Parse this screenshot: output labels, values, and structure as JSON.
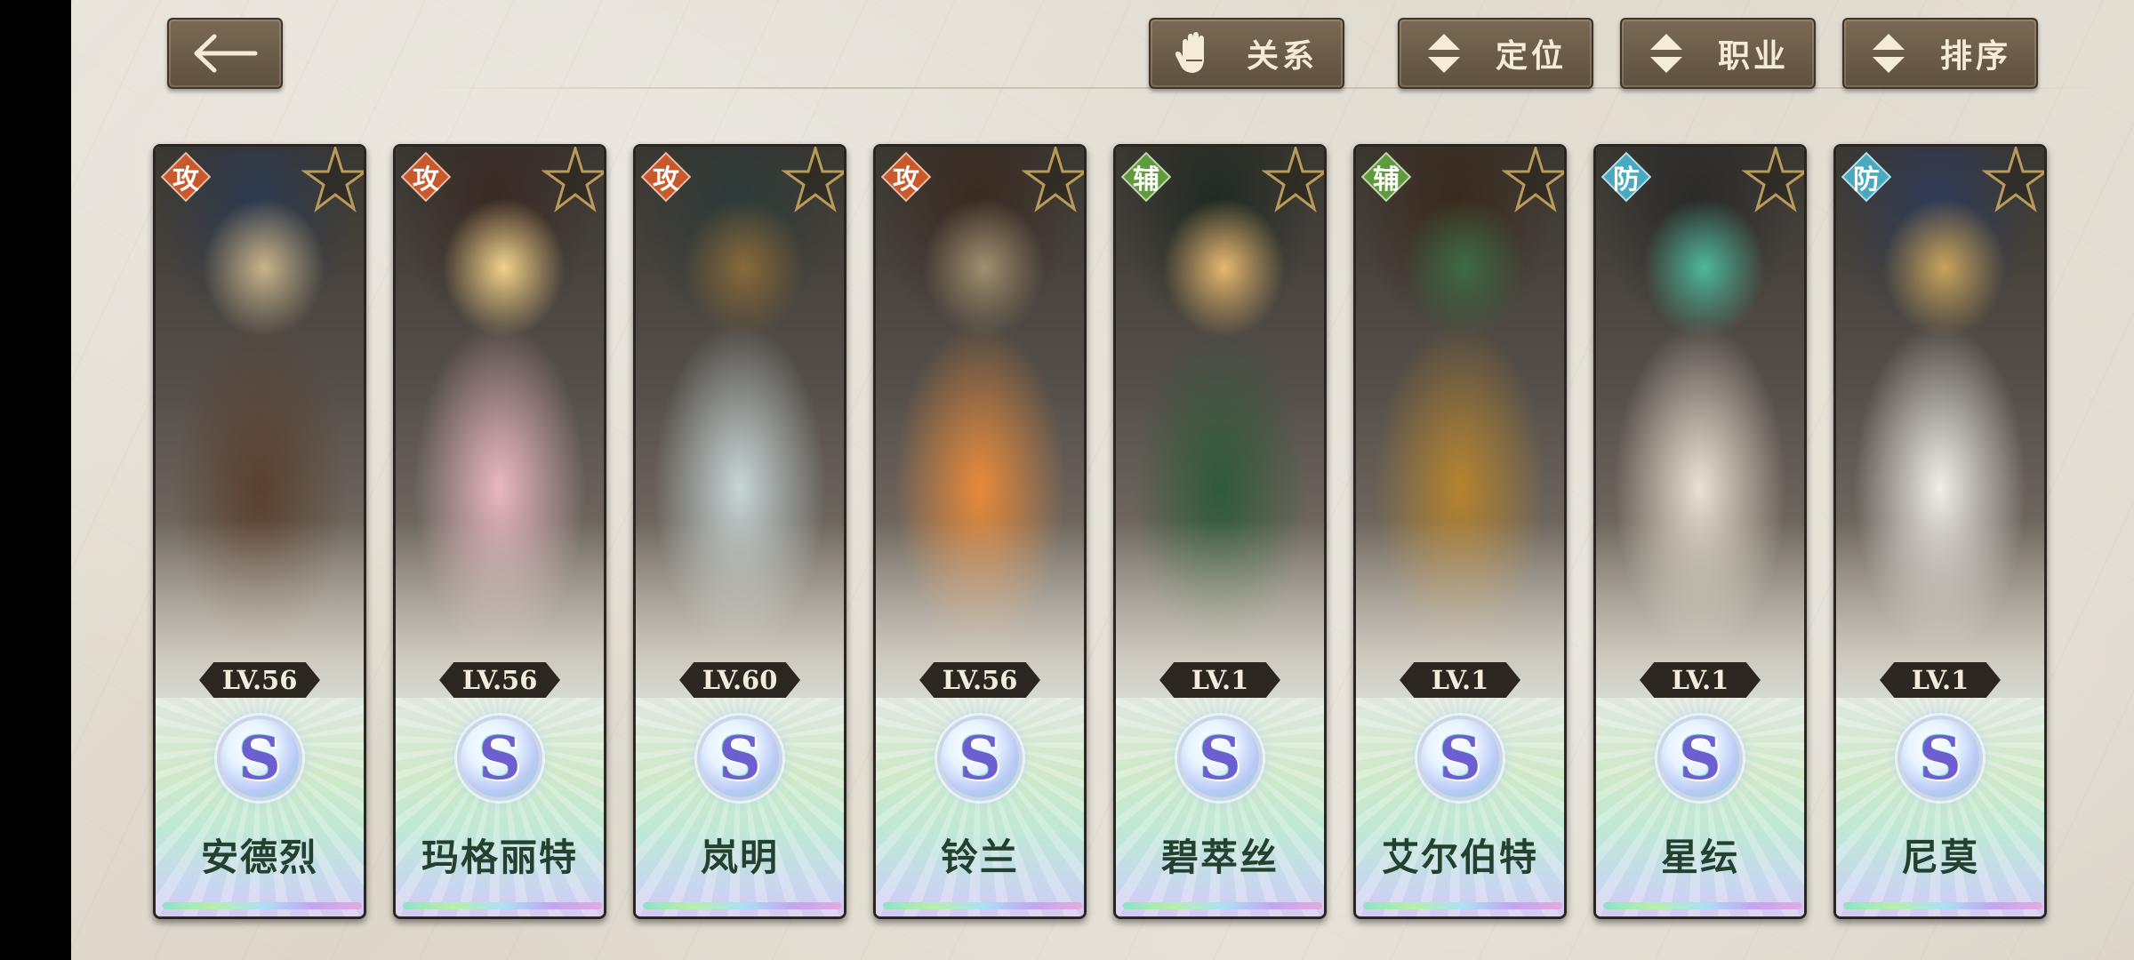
{
  "header": {
    "back_label": "←",
    "filters": [
      {
        "id": "relation",
        "label": "关系",
        "icon": "glove-icon"
      },
      {
        "id": "position",
        "label": "定位",
        "icon": "sort-arrows-icon"
      },
      {
        "id": "class",
        "label": "职业",
        "icon": "sort-arrows-icon"
      },
      {
        "id": "sort",
        "label": "排序",
        "icon": "sort-arrows-icon"
      }
    ]
  },
  "colors": {
    "attack": "#c9582a",
    "support": "#5f9b3c",
    "defense": "#4aa9c0",
    "button": "#6a5b48"
  },
  "characters": [
    {
      "name": "安德烈",
      "level": "LV.56",
      "role": "攻",
      "role_type": "attack",
      "rank": "S",
      "palette": [
        "#2c3a4e",
        "#5a4030",
        "#c9b48a"
      ]
    },
    {
      "name": "玛格丽特",
      "level": "LV.56",
      "role": "攻",
      "role_type": "attack",
      "rank": "S",
      "palette": [
        "#3a2a24",
        "#e9b7c0",
        "#f2d28a"
      ]
    },
    {
      "name": "岚明",
      "level": "LV.60",
      "role": "攻",
      "role_type": "attack",
      "rank": "S",
      "palette": [
        "#2c3a38",
        "#c7d5d6",
        "#8a6a3a"
      ]
    },
    {
      "name": "铃兰",
      "level": "LV.56",
      "role": "攻",
      "role_type": "attack",
      "rank": "S",
      "palette": [
        "#3a2b22",
        "#e88a3a",
        "#a09070"
      ]
    },
    {
      "name": "碧萃丝",
      "level": "LV.1",
      "role": "辅",
      "role_type": "support",
      "rank": "S",
      "palette": [
        "#1f2a22",
        "#2f5a3a",
        "#e7b870"
      ]
    },
    {
      "name": "艾尔伯特",
      "level": "LV.1",
      "role": "辅",
      "role_type": "support",
      "rank": "S",
      "palette": [
        "#3a2a1e",
        "#b5832e",
        "#3e6b45"
      ]
    },
    {
      "name": "星纭",
      "level": "LV.1",
      "role": "防",
      "role_type": "defense",
      "rank": "S",
      "palette": [
        "#2a2a2a",
        "#e9e2d4",
        "#4fb89a"
      ]
    },
    {
      "name": "尼莫",
      "level": "LV.1",
      "role": "防",
      "role_type": "defense",
      "rank": "S",
      "palette": [
        "#2e3a55",
        "#f1eee8",
        "#c9a45a"
      ]
    }
  ]
}
